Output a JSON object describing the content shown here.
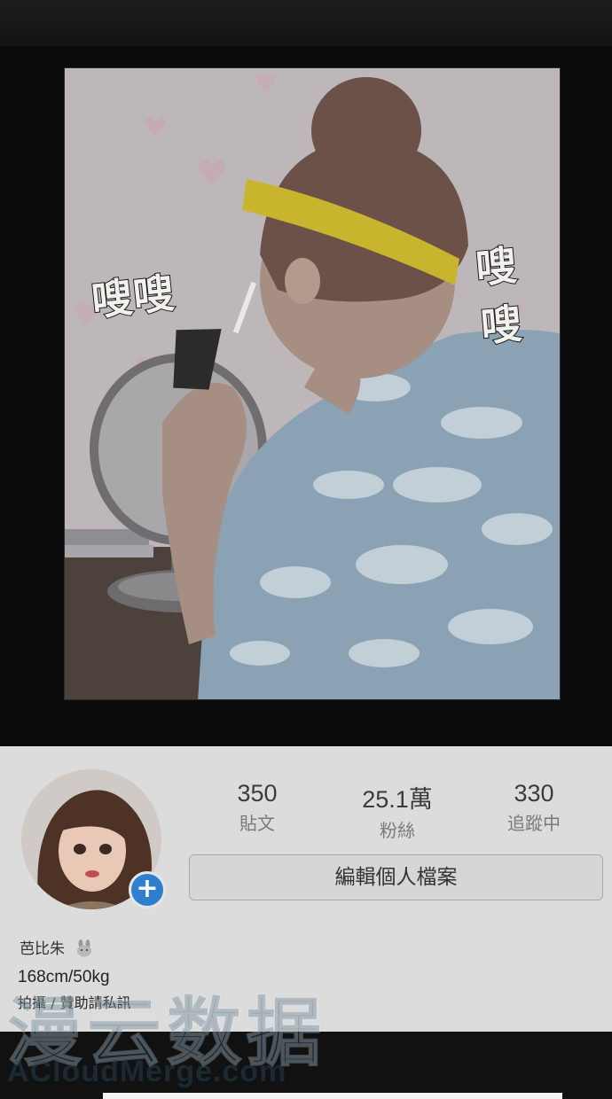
{
  "comic": {
    "sfx_left": "嗖嗖",
    "sfx_right": "嗖嗖"
  },
  "profile": {
    "stats": [
      {
        "value": "350",
        "label": "貼文"
      },
      {
        "value": "25.1萬",
        "label": "粉絲"
      },
      {
        "value": "330",
        "label": "追蹤中"
      }
    ],
    "edit_button": "編輯個人檔案",
    "add_icon": "+",
    "name": "芭比朱",
    "bio_line1": "168cm/50kg",
    "bio_line2": "拍攝 / 贊助請私訊"
  },
  "watermark": {
    "cn": "漫云数据",
    "en": "ACloudMerge.com"
  },
  "colors": {
    "accent_blue": "#2f7fd0",
    "panel_bg": "#dcdcdc",
    "shirt": "#8aa2b3",
    "headband": "#c9b52d"
  },
  "icons": [
    "plus-icon",
    "rabbit-emoji-icon"
  ]
}
